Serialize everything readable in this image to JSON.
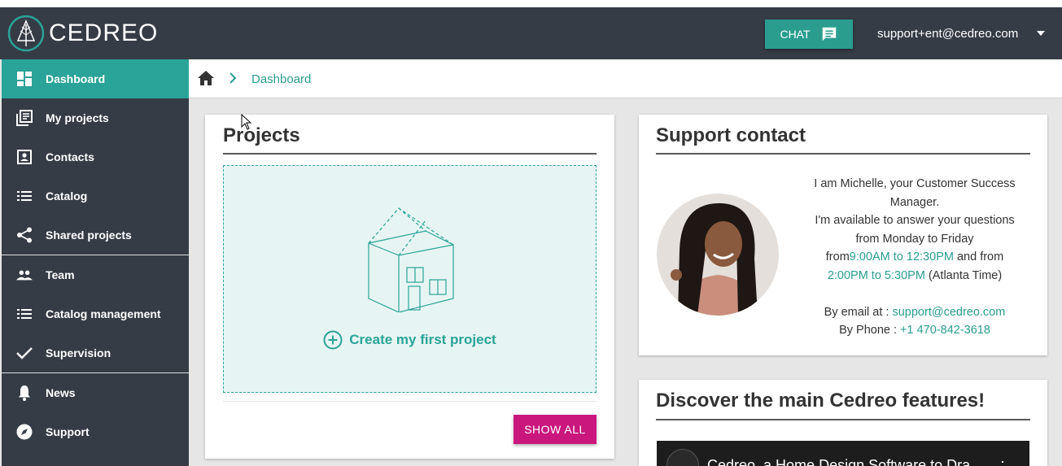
{
  "app": {
    "brand": "CEDREO",
    "brand_color": "#2aa398",
    "accent_pink": "#c9177e",
    "header_bg": "#353c46"
  },
  "header": {
    "chat_label": "CHAT",
    "user_email": "support+ent@cedreo.com"
  },
  "sidebar": {
    "items": [
      {
        "label": "Dashboard",
        "icon": "dashboard-icon",
        "active": true
      },
      {
        "label": "My projects",
        "icon": "projects-icon"
      },
      {
        "label": "Contacts",
        "icon": "contacts-icon"
      },
      {
        "label": "Catalog",
        "icon": "list-icon"
      },
      {
        "label": "Shared projects",
        "icon": "share-icon"
      },
      {
        "label": "Team",
        "icon": "team-icon"
      },
      {
        "label": "Catalog management",
        "icon": "list-icon"
      },
      {
        "label": "Supervision",
        "icon": "check-icon"
      },
      {
        "label": "News",
        "icon": "bell-icon"
      },
      {
        "label": "Support",
        "icon": "compass-icon"
      }
    ]
  },
  "breadcrumb": {
    "current": "Dashboard"
  },
  "projects": {
    "title": "Projects",
    "create_label": "Create my first project",
    "show_all": "SHOW ALL"
  },
  "support": {
    "title": "Support contact",
    "line1": "I am Michelle, your Customer Success Manager.",
    "line2": "I'm available to answer your questions from Monday to Friday",
    "from_prefix": "from",
    "hours1": "9:00AM to 12:30PM",
    "and_from": " and from",
    "hours2": "2:00PM to 5:30PM",
    "timezone": " (Atlanta Time)",
    "email_label": "By email at : ",
    "email": "support@cedreo.com",
    "phone_label": "By Phone : ",
    "phone": "+1 470-842-3618"
  },
  "features": {
    "title": "Discover the main Cedreo features!",
    "video_title": "Cedreo, a Home Design Software to Dra"
  }
}
